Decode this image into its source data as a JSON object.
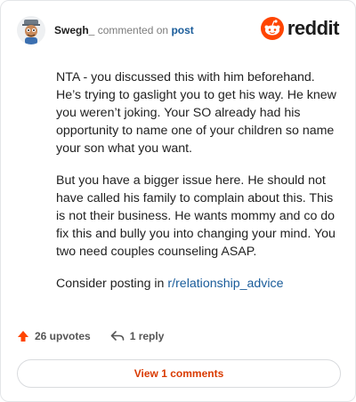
{
  "comment": {
    "username": "Swegh_",
    "verb": "commented on",
    "post_link": "post",
    "paragraphs": [
      "NTA - you discussed this with him beforehand. He’s trying to gaslight you to get his way. He knew you weren’t joking. Your SO already had his opportunity to name one of your children so name your son what you want.",
      "But you have a bigger issue here. He should not have called his family to complain about this. This is not their business. He wants mommy and co do fix this and bully you into changing your mind. You two need couples counseling ASAP."
    ],
    "closing_prefix": "Consider posting in ",
    "closing_link": "r/relationship_advice"
  },
  "brand": {
    "name": "reddit",
    "icon": "reddit-logo-icon",
    "color": "#ff4500"
  },
  "actions": {
    "upvotes": "26 upvotes",
    "upvote_icon": "upvote-arrow-icon",
    "upvote_color": "#ff4500",
    "reply": "1 reply",
    "reply_icon": "reply-arrow-icon"
  },
  "footer": {
    "view_comments": "View 1 comments",
    "accent": "#d93a00"
  }
}
